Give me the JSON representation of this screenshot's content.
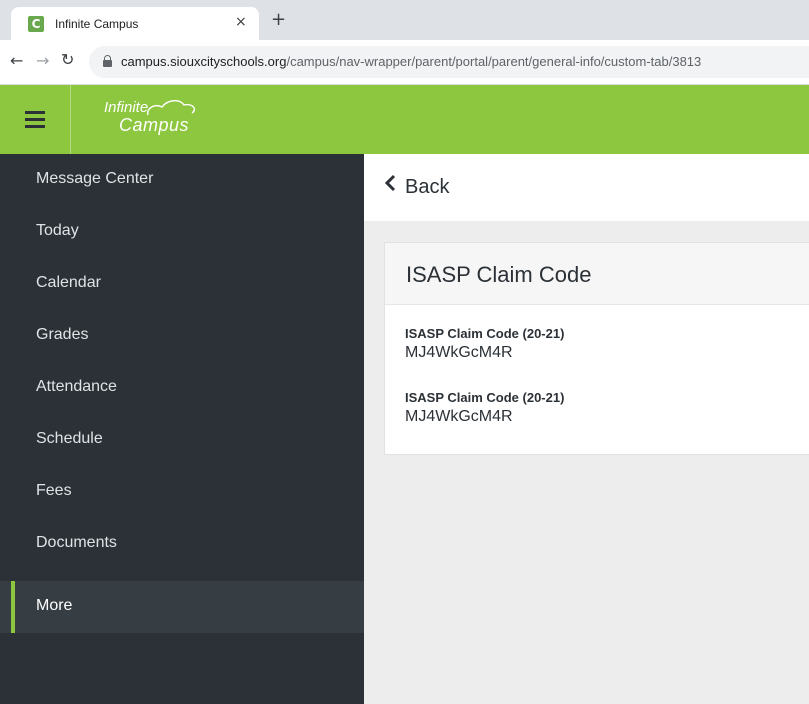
{
  "browser": {
    "tab_title": "Infinite Campus",
    "tab_close": "×",
    "new_tab": "+",
    "favicon_letter": "C",
    "url_host": "campus.siouxcityschools.org",
    "url_path": "/campus/nav-wrapper/parent/portal/parent/general-info/custom-tab/3813"
  },
  "app": {
    "logo_line1": "Infinite",
    "logo_line2": "Campus",
    "brand_color": "#8dc63f",
    "sidebar_color": "#2b3136"
  },
  "sidebar": {
    "items": [
      {
        "label": "Message Center"
      },
      {
        "label": "Today"
      },
      {
        "label": "Calendar"
      },
      {
        "label": "Grades"
      },
      {
        "label": "Attendance"
      },
      {
        "label": "Schedule"
      },
      {
        "label": "Fees"
      },
      {
        "label": "Documents"
      },
      {
        "label": "More",
        "active": true
      }
    ]
  },
  "main": {
    "back_label": "Back",
    "card": {
      "title": "ISASP Claim Code",
      "fields": [
        {
          "label": "ISASP Claim Code (20-21)",
          "value": "MJ4WkGcM4R"
        },
        {
          "label": "ISASP Claim Code (20-21)",
          "value": "MJ4WkGcM4R"
        }
      ]
    }
  }
}
